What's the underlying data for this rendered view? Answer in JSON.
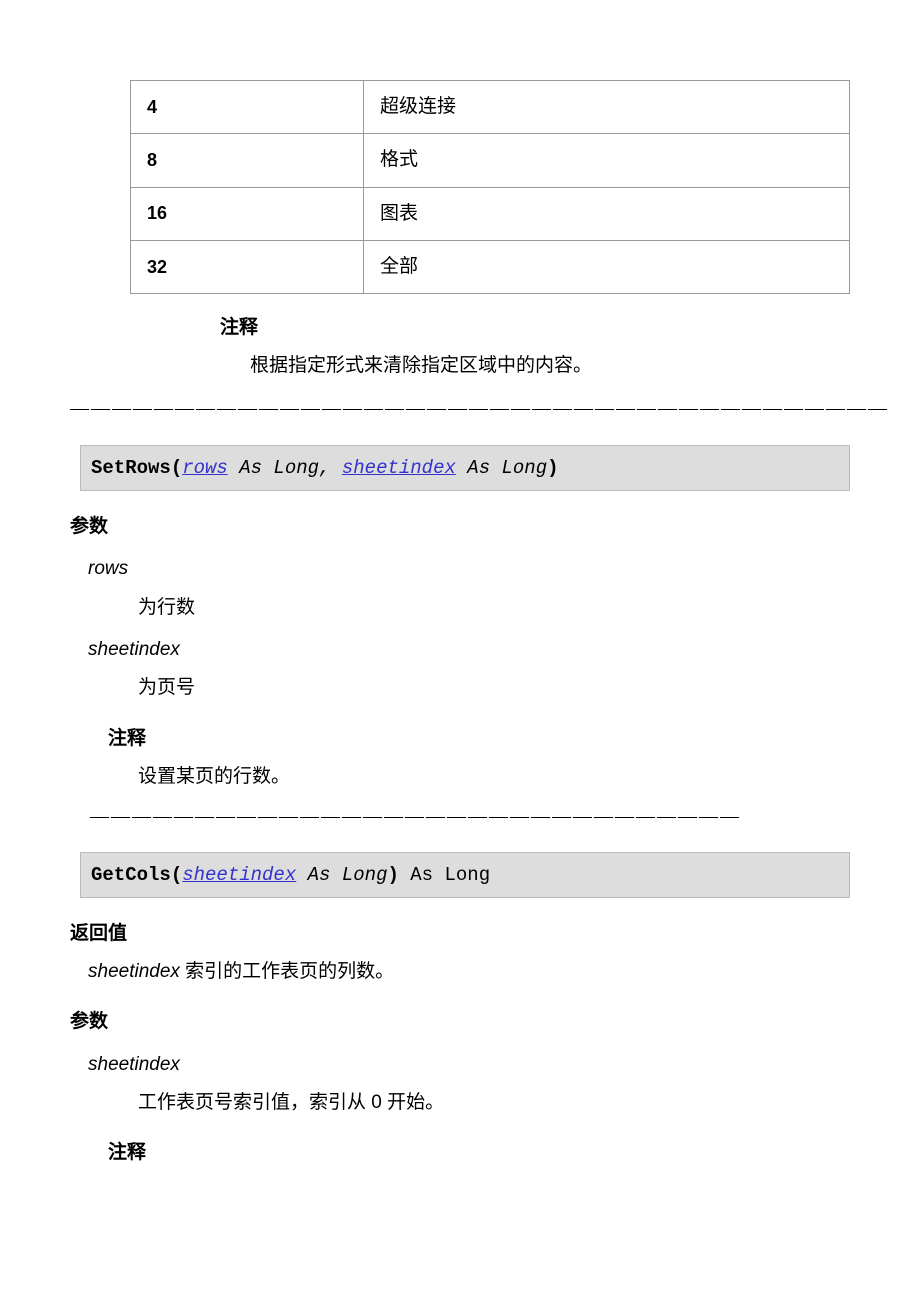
{
  "table": {
    "rows": [
      {
        "key": "4",
        "val": "超级连接"
      },
      {
        "key": "8",
        "val": "格式"
      },
      {
        "key": "16",
        "val": "图表"
      },
      {
        "key": "32",
        "val": "全部"
      }
    ]
  },
  "block1": {
    "note_head": "注释",
    "note_text": "根据指定形式来清除指定区域中的内容。",
    "dashes": "———————————————————————————————————————"
  },
  "code1": {
    "fn": "SetRows(",
    "p1": "rows",
    "mid1": " As Long, ",
    "p2": "sheetindex",
    "mid2": " As Long",
    "close": ")"
  },
  "sec1": {
    "params_label": "参数",
    "p1_name": "rows",
    "p1_desc": "为行数",
    "p2_name": "sheetindex",
    "p2_desc": "为页号",
    "note_head": "注释",
    "note_text": "设置某页的行数。",
    "dashes": "———————————————————————————————"
  },
  "code2": {
    "fn": "GetCols(",
    "p1": "sheetindex",
    "mid1": " As Long",
    "close": ")",
    "ret": " As Long"
  },
  "sec2": {
    "ret_label": "返回值",
    "ret_name": "sheetindex",
    "ret_text": " 索引的工作表页的列数。",
    "params_label": "参数",
    "p1_name": "sheetindex",
    "p1_desc": "工作表页号索引值，索引从 0 开始。",
    "note_head": "注释"
  }
}
